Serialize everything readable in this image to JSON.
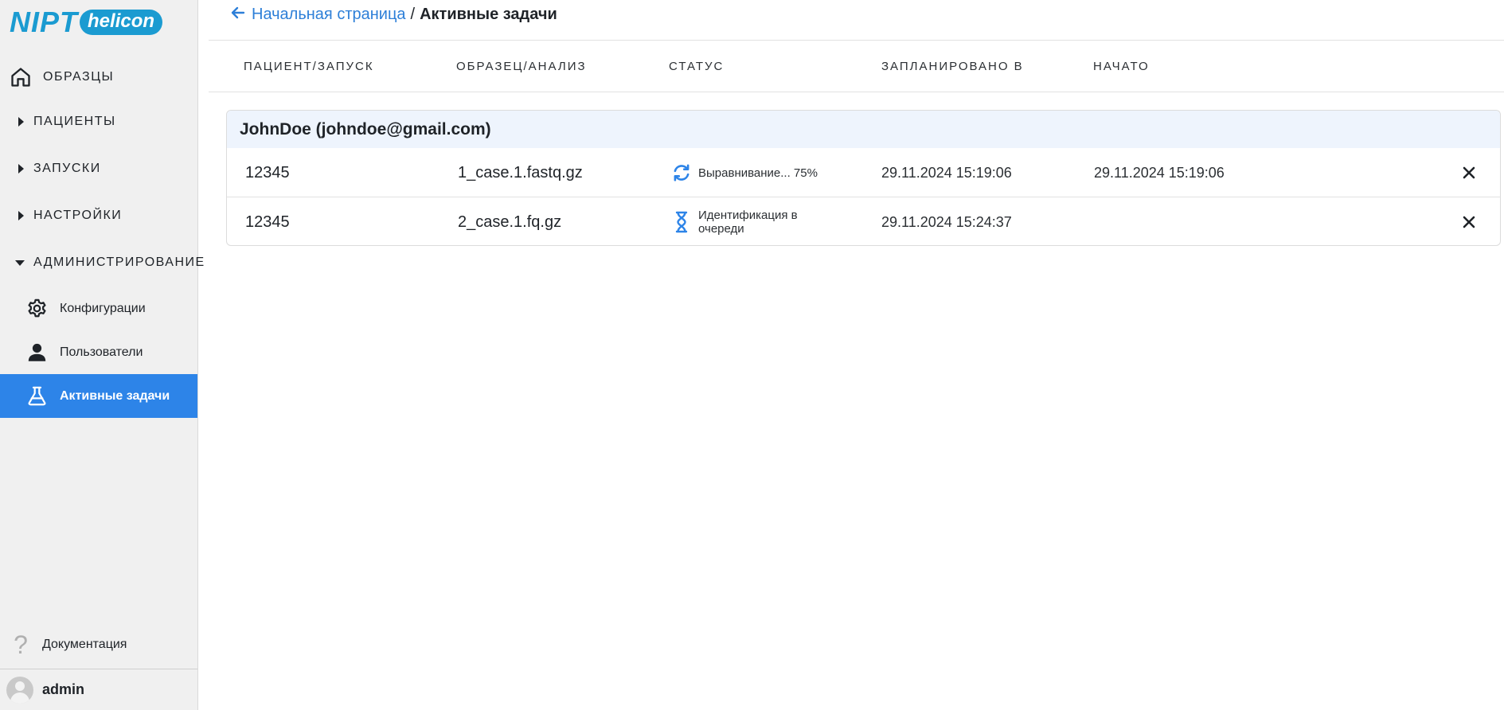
{
  "logo": {
    "primary": "NIPT",
    "secondary": "helicon"
  },
  "sidebar": {
    "samples": "ОБРАЗЦЫ",
    "patients": "ПАЦИЕНТЫ",
    "runs": "ЗАПУСКИ",
    "settings": "НАСТРОЙКИ",
    "administration": "АДМИНИСТРИРОВАНИЕ",
    "sub_items": [
      {
        "label": "Конфигурации",
        "icon": "gear-icon"
      },
      {
        "label": "Пользователи",
        "icon": "user-icon"
      },
      {
        "label": "Активные задачи",
        "icon": "flask-icon",
        "active": true
      }
    ],
    "docs": "Документация",
    "user": "admin"
  },
  "breadcrumb": {
    "home": "Начальная страница",
    "separator": "/",
    "current": "Активные задачи"
  },
  "table": {
    "headers": [
      "ПАЦИЕНТ/ЗАПУСК",
      "ОБРАЗЕЦ/АНАЛИЗ",
      "СТАТУС",
      "ЗАПЛАНИРОВАНО В",
      "НАЧАТО"
    ],
    "group": "JohnDoe (johndoe@gmail.com)",
    "rows": [
      {
        "run": "12345",
        "sample": "1_case.1.fastq.gz",
        "status": "Выравнивание... 75%",
        "status_icon": "sync-icon",
        "scheduled": "29.11.2024 15:19:06",
        "started": "29.11.2024 15:19:06"
      },
      {
        "run": "12345",
        "sample": "2_case.1.fq.gz",
        "status": "Идентификация в очереди",
        "status_icon": "hourglass-icon",
        "scheduled": "29.11.2024 15:24:37",
        "started": ""
      }
    ]
  },
  "colors": {
    "accent": "#2d84e8",
    "link": "#2d7fd8",
    "group_bg": "#eef4fd",
    "sidebar_bg": "#f0f0f0"
  }
}
